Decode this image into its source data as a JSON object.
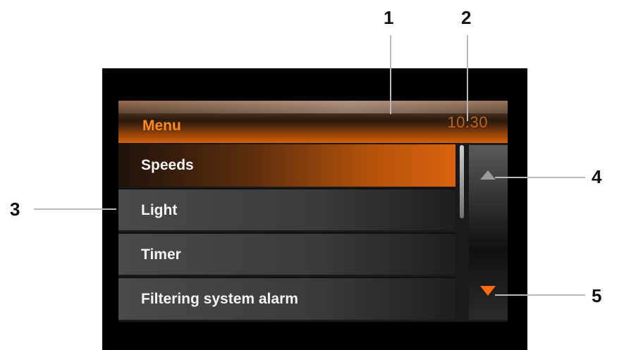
{
  "callouts": [
    "1",
    "2",
    "3",
    "4",
    "5"
  ],
  "header": {
    "title": "Menu",
    "clock": "10:30"
  },
  "menu": {
    "items": [
      {
        "label": "Speeds",
        "selected": true
      },
      {
        "label": "Light",
        "selected": false
      },
      {
        "label": "Timer",
        "selected": false
      },
      {
        "label": "Filtering system alarm",
        "selected": false
      }
    ]
  },
  "scroll": {
    "up_icon": "triangle-up",
    "down_icon": "triangle-down"
  },
  "colors": {
    "accent": "#d9620f",
    "header_text": "#ff8a1f",
    "down_arrow": "#ff6a12",
    "up_arrow": "#9a9a9a"
  }
}
